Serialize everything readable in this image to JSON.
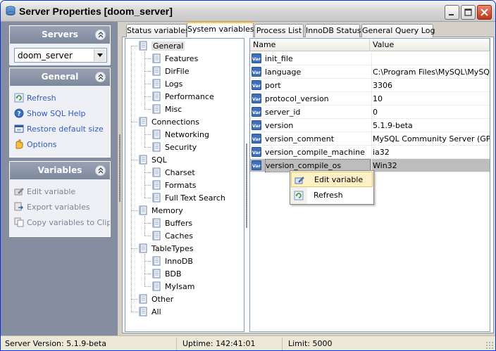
{
  "window": {
    "title": "Server Properties [doom_server]",
    "accent": "#0831d9"
  },
  "left_panel": {
    "servers": {
      "header": "Servers",
      "selected_server": "doom_server"
    },
    "general": {
      "header": "General",
      "items": [
        {
          "label": "Refresh",
          "icon": "refresh-icon",
          "enabled": true
        },
        {
          "label": "Show SQL Help",
          "icon": "help-icon",
          "enabled": true
        },
        {
          "label": "Restore default size",
          "icon": "restore-size-icon",
          "enabled": true
        },
        {
          "label": "Options",
          "icon": "options-icon",
          "enabled": true
        }
      ]
    },
    "variables": {
      "header": "Variables",
      "items": [
        {
          "label": "Edit variable",
          "icon": "edit-icon",
          "enabled": false
        },
        {
          "label": "Export variables",
          "icon": "export-icon",
          "enabled": false
        },
        {
          "label": "Copy variables to Clip...",
          "icon": "copy-icon",
          "enabled": false
        }
      ]
    }
  },
  "tabs": [
    {
      "label": "Status variables",
      "active": false
    },
    {
      "label": "System variables",
      "active": true
    },
    {
      "label": "Process List",
      "active": false
    },
    {
      "label": "InnoDB Status",
      "active": false
    },
    {
      "label": "General Query Log",
      "active": false
    }
  ],
  "tree": [
    {
      "label": "General",
      "level": 0,
      "selected": true
    },
    {
      "label": "Features",
      "level": 1
    },
    {
      "label": "DirFile",
      "level": 1
    },
    {
      "label": "Logs",
      "level": 1
    },
    {
      "label": "Performance",
      "level": 1
    },
    {
      "label": "Misc",
      "level": 1
    },
    {
      "label": "Connections",
      "level": 0
    },
    {
      "label": "Networking",
      "level": 1
    },
    {
      "label": "Security",
      "level": 1
    },
    {
      "label": "SQL",
      "level": 0
    },
    {
      "label": "Charset",
      "level": 1
    },
    {
      "label": "Formats",
      "level": 1
    },
    {
      "label": "Full Text Search",
      "level": 1
    },
    {
      "label": "Memory",
      "level": 0
    },
    {
      "label": "Buffers",
      "level": 1
    },
    {
      "label": "Caches",
      "level": 1
    },
    {
      "label": "TableTypes",
      "level": 0
    },
    {
      "label": "InnoDB",
      "level": 1
    },
    {
      "label": "BDB",
      "level": 1
    },
    {
      "label": "MyIsam",
      "level": 1
    },
    {
      "label": "Other",
      "level": 0
    },
    {
      "label": "All",
      "level": 0
    }
  ],
  "grid": {
    "columns": [
      "Name",
      "Value"
    ],
    "rows": [
      {
        "name": "init_file",
        "value": ""
      },
      {
        "name": "language",
        "value": "C:\\Program Files\\MySQL\\MySQL Se"
      },
      {
        "name": "port",
        "value": "3306"
      },
      {
        "name": "protocol_version",
        "value": "10"
      },
      {
        "name": "server_id",
        "value": "0"
      },
      {
        "name": "version",
        "value": "5.1.9-beta"
      },
      {
        "name": "version_comment",
        "value": "MySQL Community Server (GPL)"
      },
      {
        "name": "version_compile_machine",
        "value": "ia32"
      },
      {
        "name": "version_compile_os",
        "value": "Win32",
        "selected": true
      }
    ]
  },
  "context_menu": {
    "items": [
      {
        "label": "Edit variable",
        "icon": "edit-icon",
        "highlighted": true
      },
      {
        "label": "Refresh",
        "icon": "refresh-icon",
        "highlighted": false
      }
    ]
  },
  "statusbar": {
    "server_version": "Server Version: 5.1.9-beta",
    "uptime": "Uptime: 142:41:01",
    "limit": "Limit: 5000"
  }
}
